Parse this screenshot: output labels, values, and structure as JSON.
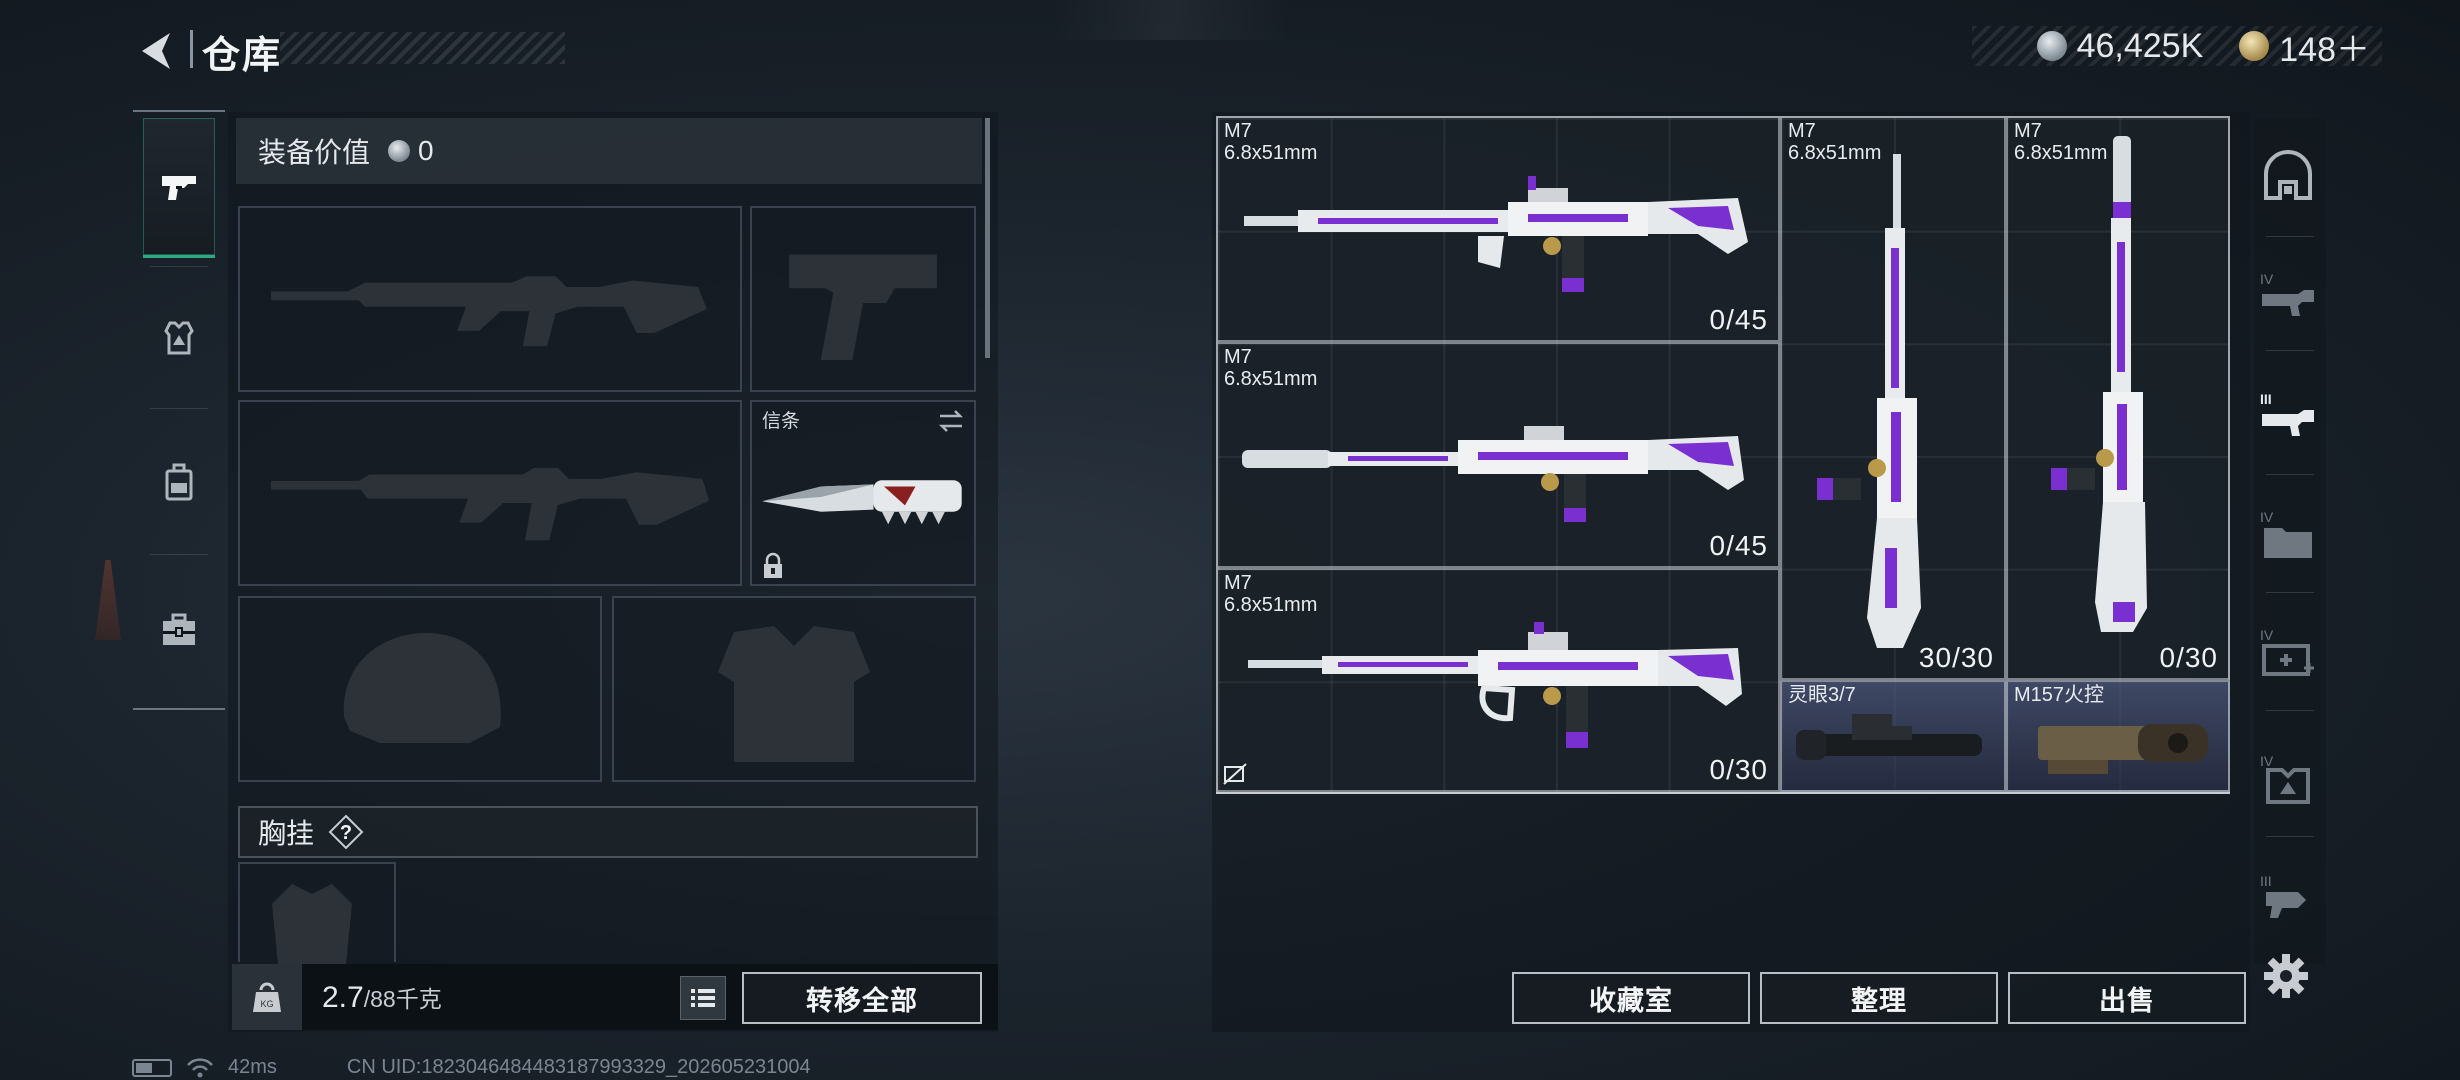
{
  "header": {
    "title": "仓库",
    "currency": [
      {
        "icon": "silver-coin-icon",
        "value": "46,425K"
      },
      {
        "icon": "gold-coin-icon",
        "value": "148＋"
      }
    ]
  },
  "tabs": [
    {
      "name": "weapons-tab",
      "icon": "pistol-icon",
      "active": true
    },
    {
      "name": "armor-tab",
      "icon": "armor-vest-icon"
    },
    {
      "name": "backpack-tab",
      "icon": "backpack-icon"
    },
    {
      "name": "toolbox-tab",
      "icon": "toolbox-icon"
    }
  ],
  "loadout": {
    "equip_value_label": "装备价值",
    "equip_value": "0",
    "melee_label": "信条",
    "chest_label": "胸挂",
    "help_symbol": "?",
    "weight": "2.7",
    "weight_cap": "/88千克",
    "transfer_all": "转移全部"
  },
  "storage": {
    "items": [
      {
        "name": "M7",
        "ammo": "6.8x51mm",
        "count": "0/45"
      },
      {
        "name": "M7",
        "ammo": "6.8x51mm",
        "count": "0/45"
      },
      {
        "name": "M7",
        "ammo": "6.8x51mm",
        "count": "0/30"
      },
      {
        "name": "M7",
        "ammo": "6.8x51mm",
        "count": "30/30"
      },
      {
        "name": "M7",
        "ammo": "6.8x51mm",
        "count": "0/30"
      },
      {
        "name": "灵眼3/7"
      },
      {
        "name": "M157火控"
      }
    ],
    "buttons": {
      "collection": "收藏室",
      "sort": "整理",
      "sell": "出售"
    }
  },
  "rail": [
    "helmet-category-icon",
    "iv-rifle-icon",
    "iii-rifle-icon",
    "iv-folder-icon",
    "iv-medkit-icon",
    "iv-armor-icon",
    "iii-grenade-icon"
  ],
  "status": {
    "ping": "42ms",
    "uid": "CN UID:1823046484483187993329_202605231004"
  },
  "colors": {
    "accent": "#2fa882",
    "skin_purple": "#7a2fd0"
  }
}
